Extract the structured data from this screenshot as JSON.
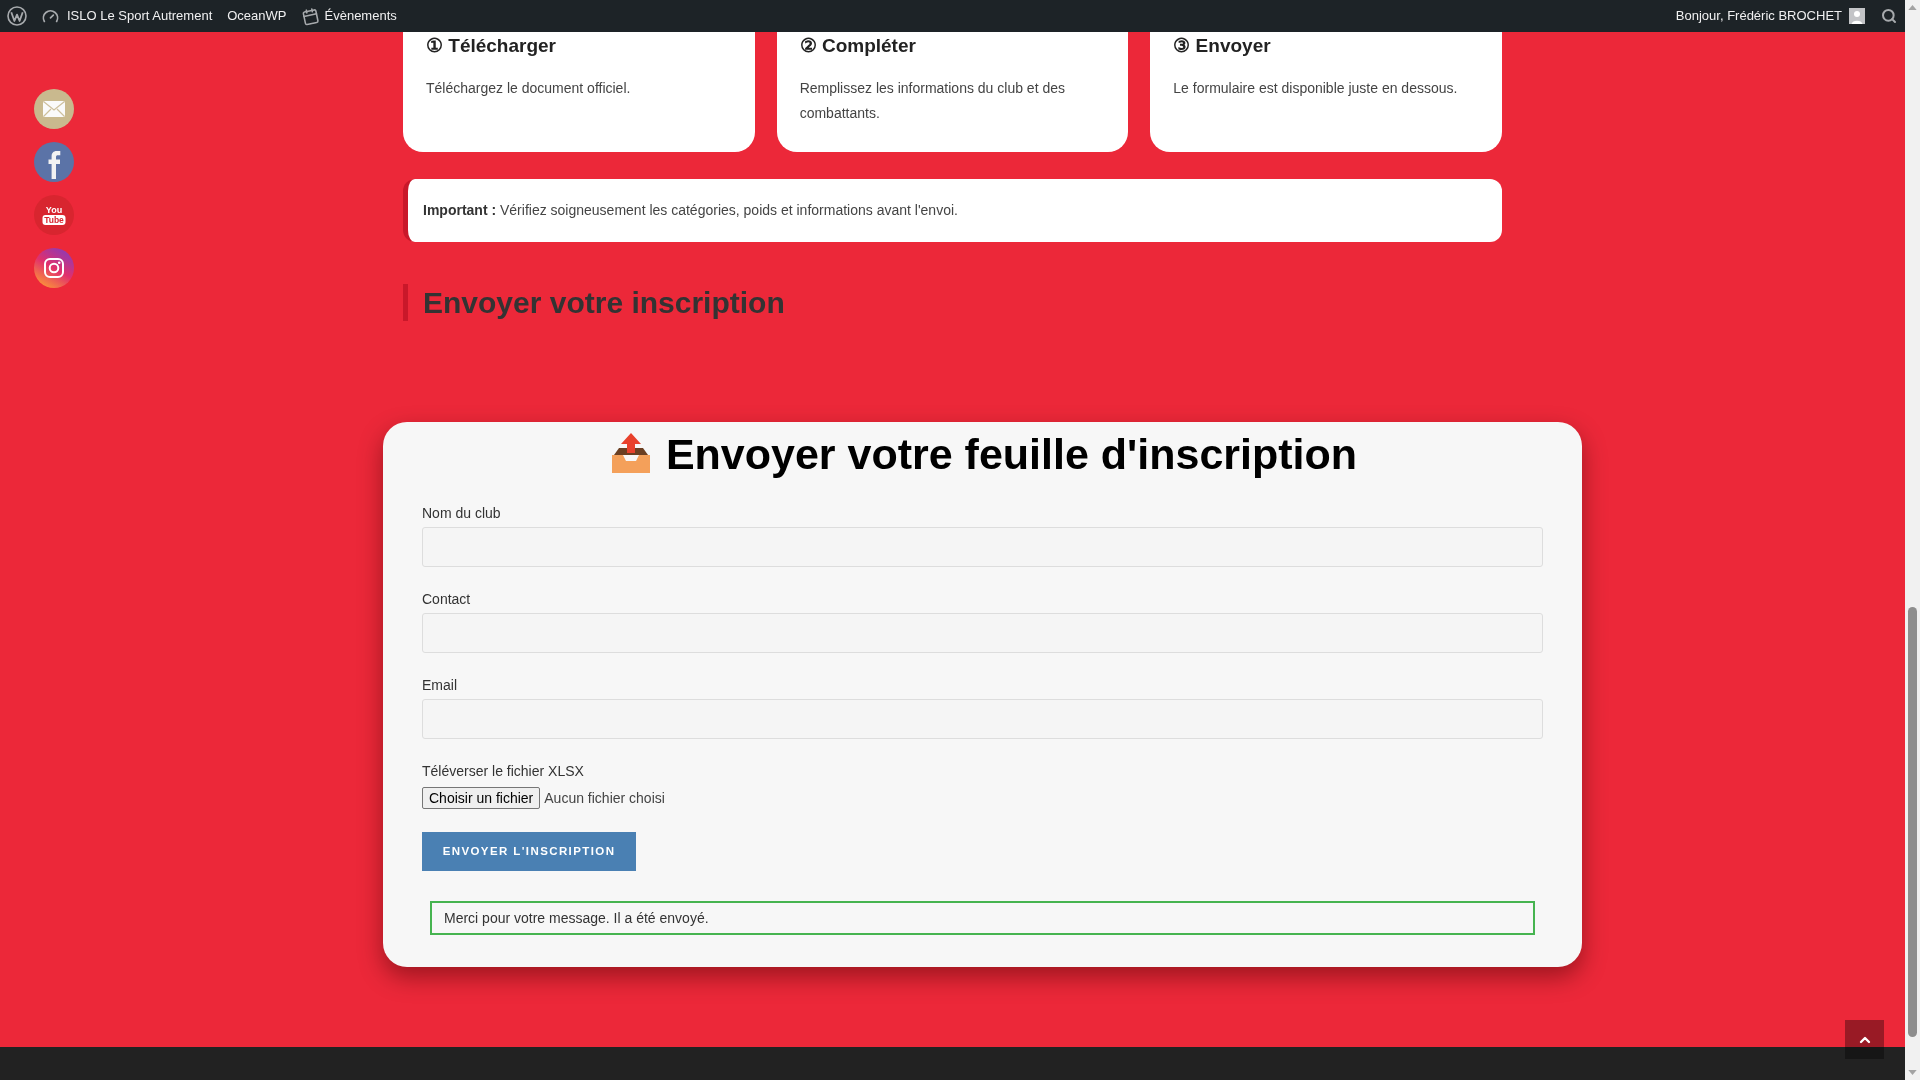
{
  "admin_bar": {
    "items": [
      {
        "kind": "logo"
      },
      {
        "kind": "site",
        "label": "ISLO Le Sport Autrement"
      },
      {
        "kind": "link",
        "label": "OceanWP"
      },
      {
        "kind": "events",
        "label": "Évènements"
      }
    ],
    "account": {
      "greeting": "Bonjour, Frédéric BROCHET"
    }
  },
  "social_links": [
    {
      "kind": "email"
    },
    {
      "kind": "facebook"
    },
    {
      "kind": "youtube",
      "label_lines": [
        "You",
        "Tube"
      ]
    },
    {
      "kind": "instagram"
    }
  ],
  "steps": [
    {
      "title": "① Télécharger",
      "text": "Téléchargez le document officiel."
    },
    {
      "title": "② Compléter",
      "text": "Remplissez les informations du club et des combattants."
    },
    {
      "title": "③ Envoyer",
      "text": "Le formulaire est disponible juste en dessous."
    }
  ],
  "notice": "**Important :** Vérifiez soigneusement les catégories, poids et informations avant l'envoi.",
  "section_heading": "Envoyer votre inscription",
  "form": {
    "title": "Envoyer votre feuille d'inscription",
    "fields": [
      {
        "kind": "text",
        "label": "Nom du club"
      },
      {
        "kind": "text",
        "label": "Contact"
      },
      {
        "kind": "text",
        "label": "Email"
      },
      {
        "kind": "file",
        "label": "Téléverser le fichier XLSX",
        "button": "Choisir un fichier",
        "status": "Aucun fichier choisi"
      }
    ],
    "submit": "ENVOYER L'INSCRIPTION",
    "response": "Merci pour votre message. Il a été envoyé."
  }
}
